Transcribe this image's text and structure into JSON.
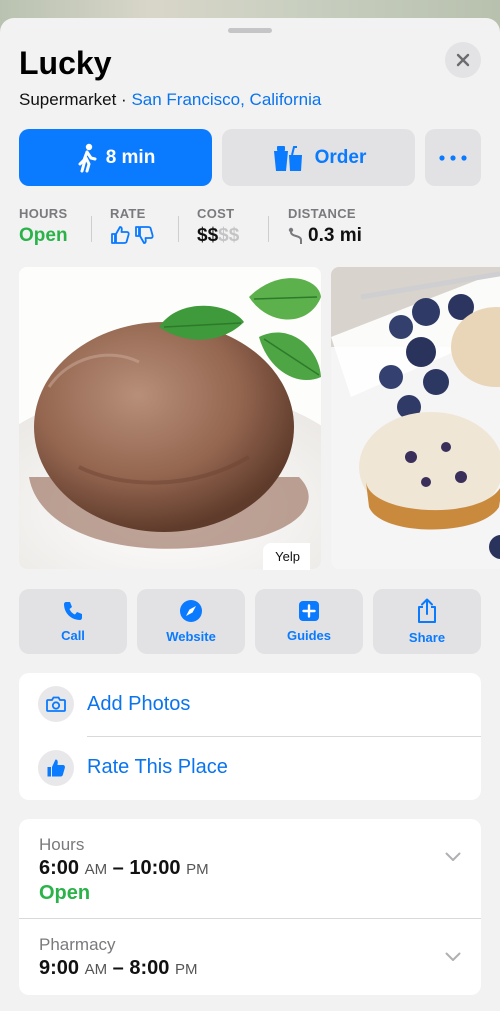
{
  "place": {
    "name": "Lucky",
    "category": "Supermarket",
    "separator": " · ",
    "location": "San Francisco, California"
  },
  "actions": {
    "walk_time": "8 min",
    "order_label": "Order"
  },
  "stats": {
    "hours_label": "HOURS",
    "hours_value": "Open",
    "rate_label": "RATE",
    "cost_label": "COST",
    "cost_value": "$$",
    "cost_faded": "$$",
    "distance_label": "DISTANCE",
    "distance_value": "0.3 mi"
  },
  "photos": {
    "credit": "Yelp"
  },
  "quick_actions": [
    {
      "label": "Call",
      "icon": "phone-icon"
    },
    {
      "label": "Website",
      "icon": "compass-icon"
    },
    {
      "label": "Guides",
      "icon": "plus-square-icon"
    },
    {
      "label": "Share",
      "icon": "share-icon"
    }
  ],
  "contribute": {
    "add_photos": "Add Photos",
    "rate_place": "Rate This Place"
  },
  "hours": {
    "label": "Hours",
    "open_time": "6:00",
    "open_ampm": "AM",
    "dash": " – ",
    "close_time": "10:00",
    "close_ampm": "PM",
    "status": "Open"
  },
  "pharmacy": {
    "label": "Pharmacy",
    "open_time": "9:00",
    "open_ampm": "AM",
    "dash": " – ",
    "close_time": "8:00",
    "close_ampm": "PM"
  },
  "colors": {
    "accent": "#0a7aff",
    "open_green": "#2bb34a",
    "background": "#f2f2f2"
  }
}
